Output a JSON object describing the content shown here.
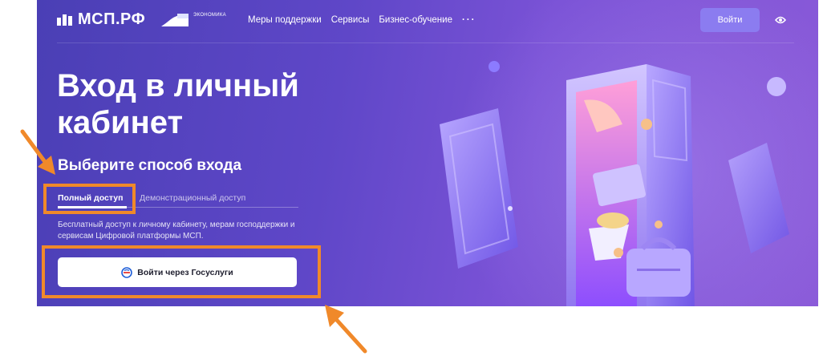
{
  "header": {
    "logo_text": "МСП.РФ",
    "partner_text": "ЭКОНОМИКА",
    "nav": [
      "Меры поддержки",
      "Сервисы",
      "Бизнес-обучение",
      "···"
    ],
    "login_label": "Войти"
  },
  "main": {
    "title": "Вход в личный кабинет",
    "subtitle": "Выберите способ входа",
    "tabs": [
      {
        "label": "Полный доступ",
        "active": true
      },
      {
        "label": "Демонстрационный доступ",
        "active": false
      }
    ],
    "description": "Бесплатный доступ к личному кабинету, мерам господдержки и сервисам Цифровой платформы МСП.",
    "gosuslugi_button": "Войти через Госуслуги"
  },
  "colors": {
    "hero": "#5f47c8",
    "login_button": "#8b7cf0",
    "annotation": "#f0892a"
  },
  "icons": [
    "logo-mark-icon",
    "economy-flag-icon",
    "eye-icon",
    "gosuslugi-icon",
    "door-illustration"
  ]
}
